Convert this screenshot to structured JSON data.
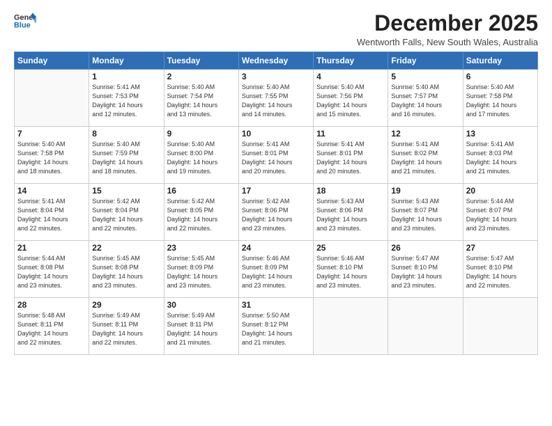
{
  "logo": {
    "line1": "General",
    "line2": "Blue"
  },
  "title": "December 2025",
  "subtitle": "Wentworth Falls, New South Wales, Australia",
  "days_of_week": [
    "Sunday",
    "Monday",
    "Tuesday",
    "Wednesday",
    "Thursday",
    "Friday",
    "Saturday"
  ],
  "weeks": [
    [
      {
        "day": "",
        "info": ""
      },
      {
        "day": "1",
        "info": "Sunrise: 5:41 AM\nSunset: 7:53 PM\nDaylight: 14 hours\nand 12 minutes."
      },
      {
        "day": "2",
        "info": "Sunrise: 5:40 AM\nSunset: 7:54 PM\nDaylight: 14 hours\nand 13 minutes."
      },
      {
        "day": "3",
        "info": "Sunrise: 5:40 AM\nSunset: 7:55 PM\nDaylight: 14 hours\nand 14 minutes."
      },
      {
        "day": "4",
        "info": "Sunrise: 5:40 AM\nSunset: 7:56 PM\nDaylight: 14 hours\nand 15 minutes."
      },
      {
        "day": "5",
        "info": "Sunrise: 5:40 AM\nSunset: 7:57 PM\nDaylight: 14 hours\nand 16 minutes."
      },
      {
        "day": "6",
        "info": "Sunrise: 5:40 AM\nSunset: 7:58 PM\nDaylight: 14 hours\nand 17 minutes."
      }
    ],
    [
      {
        "day": "7",
        "info": "Sunrise: 5:40 AM\nSunset: 7:58 PM\nDaylight: 14 hours\nand 18 minutes."
      },
      {
        "day": "8",
        "info": "Sunrise: 5:40 AM\nSunset: 7:59 PM\nDaylight: 14 hours\nand 18 minutes."
      },
      {
        "day": "9",
        "info": "Sunrise: 5:40 AM\nSunset: 8:00 PM\nDaylight: 14 hours\nand 19 minutes."
      },
      {
        "day": "10",
        "info": "Sunrise: 5:41 AM\nSunset: 8:01 PM\nDaylight: 14 hours\nand 20 minutes."
      },
      {
        "day": "11",
        "info": "Sunrise: 5:41 AM\nSunset: 8:01 PM\nDaylight: 14 hours\nand 20 minutes."
      },
      {
        "day": "12",
        "info": "Sunrise: 5:41 AM\nSunset: 8:02 PM\nDaylight: 14 hours\nand 21 minutes."
      },
      {
        "day": "13",
        "info": "Sunrise: 5:41 AM\nSunset: 8:03 PM\nDaylight: 14 hours\nand 21 minutes."
      }
    ],
    [
      {
        "day": "14",
        "info": "Sunrise: 5:41 AM\nSunset: 8:04 PM\nDaylight: 14 hours\nand 22 minutes."
      },
      {
        "day": "15",
        "info": "Sunrise: 5:42 AM\nSunset: 8:04 PM\nDaylight: 14 hours\nand 22 minutes."
      },
      {
        "day": "16",
        "info": "Sunrise: 5:42 AM\nSunset: 8:05 PM\nDaylight: 14 hours\nand 22 minutes."
      },
      {
        "day": "17",
        "info": "Sunrise: 5:42 AM\nSunset: 8:06 PM\nDaylight: 14 hours\nand 23 minutes."
      },
      {
        "day": "18",
        "info": "Sunrise: 5:43 AM\nSunset: 8:06 PM\nDaylight: 14 hours\nand 23 minutes."
      },
      {
        "day": "19",
        "info": "Sunrise: 5:43 AM\nSunset: 8:07 PM\nDaylight: 14 hours\nand 23 minutes."
      },
      {
        "day": "20",
        "info": "Sunrise: 5:44 AM\nSunset: 8:07 PM\nDaylight: 14 hours\nand 23 minutes."
      }
    ],
    [
      {
        "day": "21",
        "info": "Sunrise: 5:44 AM\nSunset: 8:08 PM\nDaylight: 14 hours\nand 23 minutes."
      },
      {
        "day": "22",
        "info": "Sunrise: 5:45 AM\nSunset: 8:08 PM\nDaylight: 14 hours\nand 23 minutes."
      },
      {
        "day": "23",
        "info": "Sunrise: 5:45 AM\nSunset: 8:09 PM\nDaylight: 14 hours\nand 23 minutes."
      },
      {
        "day": "24",
        "info": "Sunrise: 5:46 AM\nSunset: 8:09 PM\nDaylight: 14 hours\nand 23 minutes."
      },
      {
        "day": "25",
        "info": "Sunrise: 5:46 AM\nSunset: 8:10 PM\nDaylight: 14 hours\nand 23 minutes."
      },
      {
        "day": "26",
        "info": "Sunrise: 5:47 AM\nSunset: 8:10 PM\nDaylight: 14 hours\nand 23 minutes."
      },
      {
        "day": "27",
        "info": "Sunrise: 5:47 AM\nSunset: 8:10 PM\nDaylight: 14 hours\nand 22 minutes."
      }
    ],
    [
      {
        "day": "28",
        "info": "Sunrise: 5:48 AM\nSunset: 8:11 PM\nDaylight: 14 hours\nand 22 minutes."
      },
      {
        "day": "29",
        "info": "Sunrise: 5:49 AM\nSunset: 8:11 PM\nDaylight: 14 hours\nand 22 minutes."
      },
      {
        "day": "30",
        "info": "Sunrise: 5:49 AM\nSunset: 8:11 PM\nDaylight: 14 hours\nand 21 minutes."
      },
      {
        "day": "31",
        "info": "Sunrise: 5:50 AM\nSunset: 8:12 PM\nDaylight: 14 hours\nand 21 minutes."
      },
      {
        "day": "",
        "info": ""
      },
      {
        "day": "",
        "info": ""
      },
      {
        "day": "",
        "info": ""
      }
    ]
  ]
}
